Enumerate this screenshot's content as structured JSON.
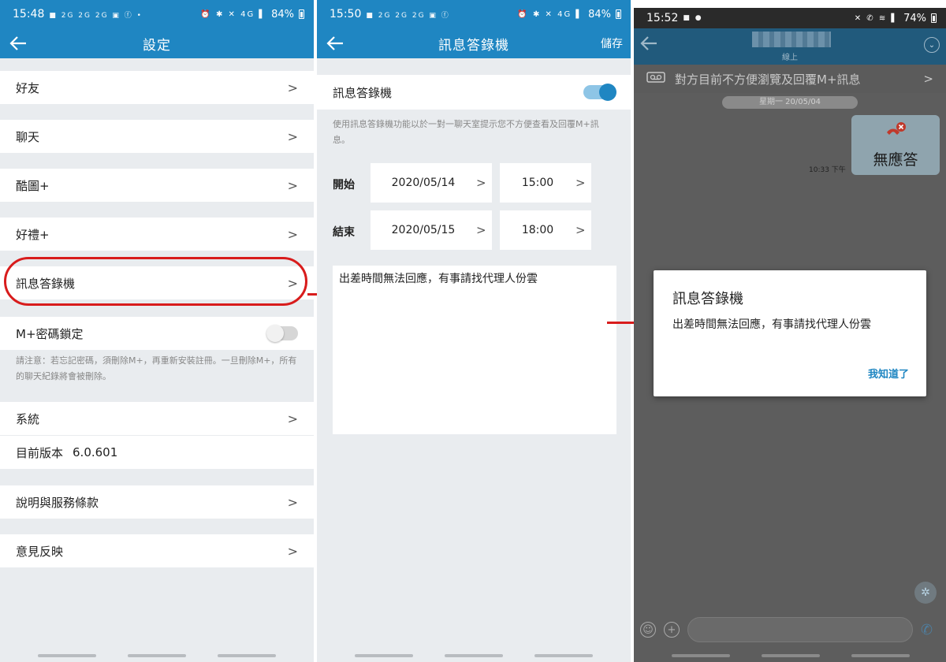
{
  "panel1": {
    "status": {
      "time": "15:48",
      "icons": "■ 2G 2G 2G ▣ ⓕ •",
      "sys": "⏰ ✱ ✕ 4G ▌",
      "battery": "84%"
    },
    "title": "設定",
    "rows": [
      {
        "label": "好友"
      },
      {
        "label": "聊天"
      },
      {
        "label": "酷圖+"
      },
      {
        "label": "好禮+"
      },
      {
        "label": "訊息答錄機"
      }
    ],
    "lock": {
      "label": "M+密碼鎖定",
      "note": "請注意：若忘記密碼，須刪除M+，再重新安裝註冊。一旦刪除M+，所有的聊天紀錄將會被刪除。",
      "enabled": false
    },
    "system": "系統",
    "version_label": "目前版本",
    "version": "6.0.601",
    "terms": "說明與服務條款",
    "feedback": "意見反映"
  },
  "panel2": {
    "status": {
      "time": "15:50",
      "icons": "■ 2G 2G 2G ▣ ⓕ",
      "sys": "⏰ ✱ ✕ 4G ▌",
      "battery": "84%"
    },
    "title": "訊息答錄機",
    "save": "儲存",
    "toggle_label": "訊息答錄機",
    "enabled": true,
    "description": "使用訊息答錄機功能以於一對一聊天室提示您不方便查看及回覆M+訊息。",
    "start": {
      "label": "開始",
      "date": "2020/05/14",
      "time": "15:00"
    },
    "end": {
      "label": "結束",
      "date": "2020/05/15",
      "time": "18:00"
    },
    "message": "出差時間無法回應，有事請找代理人份雲"
  },
  "panel3": {
    "status": {
      "time": "15:52",
      "icons": "■ ●",
      "sys": "✕ ✆ ≋ ▌",
      "battery": "74%"
    },
    "online": "線上",
    "autoreply_banner": "對方目前不方便瀏覽及回覆M+訊息",
    "date_chip": "星期一 20/05/04",
    "bubble_label": "無應答",
    "msg_time": "10:33 下午",
    "dialog": {
      "title": "訊息答錄機",
      "body": "出差時間無法回應，有事請找代理人份雲",
      "button": "我知道了"
    }
  },
  "colors": {
    "primary": "#1f86c2",
    "highlight": "#d81c1c",
    "background": "#e9ecef"
  }
}
